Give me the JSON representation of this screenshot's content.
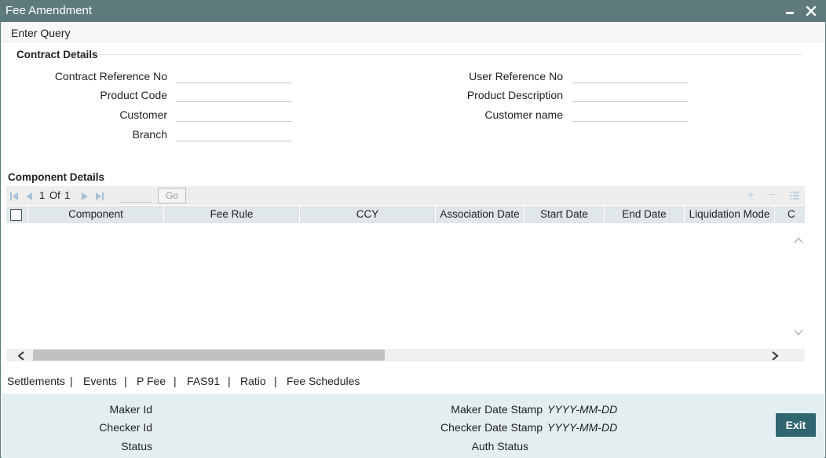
{
  "window": {
    "title": "Fee Amendment",
    "minimize_icon": "minimize-icon",
    "close_icon": "close-icon"
  },
  "toolbar": {
    "enter_query_label": "Enter Query"
  },
  "contract_details": {
    "title": "Contract Details",
    "fields": {
      "contract_reference_no": {
        "label": "Contract Reference No",
        "value": ""
      },
      "product_code": {
        "label": "Product Code",
        "value": ""
      },
      "customer": {
        "label": "Customer",
        "value": ""
      },
      "branch": {
        "label": "Branch",
        "value": ""
      },
      "user_reference_no": {
        "label": "User Reference No",
        "value": ""
      },
      "product_description": {
        "label": "Product Description",
        "value": ""
      },
      "customer_name": {
        "label": "Customer name",
        "value": ""
      }
    }
  },
  "component_details": {
    "title": "Component Details",
    "pager": {
      "current": "1",
      "of_label": "Of",
      "total": "1",
      "go_label": "Go"
    },
    "columns": [
      "Component",
      "Fee Rule",
      "CCY",
      "Association Date",
      "Start Date",
      "End Date",
      "Liquidation Mode",
      "C"
    ],
    "rows": []
  },
  "tabs": [
    "Settlements",
    "Events",
    "P Fee",
    "FAS91",
    "Ratio",
    "Fee Schedules"
  ],
  "tab_separator": "|",
  "footer": {
    "maker_id_label": "Maker Id",
    "checker_id_label": "Checker Id",
    "status_label": "Status",
    "maker_date_stamp_label": "Maker Date Stamp",
    "maker_date_stamp_value": "YYYY-MM-DD",
    "checker_date_stamp_label": "Checker Date Stamp",
    "checker_date_stamp_value": "YYYY-MM-DD",
    "auth_status_label": "Auth Status",
    "exit_label": "Exit"
  },
  "colors": {
    "titlebar": "#5e7a7c",
    "grid_header": "#dfe7ea",
    "footer": "#e3eef0",
    "exit_button": "#2f6670"
  }
}
